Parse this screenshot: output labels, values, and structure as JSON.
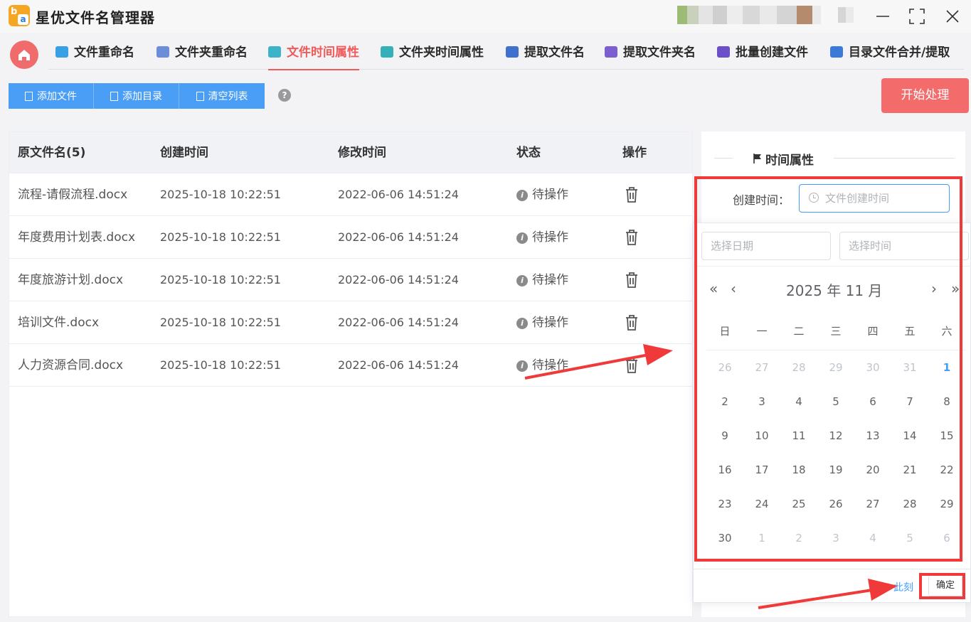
{
  "app": {
    "logo_b": "b",
    "logo_a": "a",
    "title": "星优文件名管理器"
  },
  "nav": {
    "items": [
      {
        "label": "文件重命名",
        "icon": "file-rename-icon",
        "color": "#3aa0e6"
      },
      {
        "label": "文件夹重命名",
        "icon": "folder-rename-icon",
        "color": "#6a8fd8"
      },
      {
        "label": "文件时间属性",
        "icon": "file-time-icon",
        "color": "#3bb3c8"
      },
      {
        "label": "文件夹时间属性",
        "icon": "folder-time-icon",
        "color": "#36b0b8"
      },
      {
        "label": "提取文件名",
        "icon": "extract-filename-icon",
        "color": "#3f6fcf"
      },
      {
        "label": "提取文件夹名",
        "icon": "extract-foldername-icon",
        "color": "#7b5fcf"
      },
      {
        "label": "批量创建文件",
        "icon": "batch-create-icon",
        "color": "#6a4fc8"
      },
      {
        "label": "目录文件合并/提取",
        "icon": "merge-extract-icon",
        "color": "#3a7ad8"
      }
    ],
    "active_index": 2
  },
  "toolbar": {
    "add_file": "添加文件",
    "add_dir": "添加目录",
    "clear_list": "清空列表",
    "help": "?",
    "start": "开始处理"
  },
  "table": {
    "headers": [
      "原文件名(5)",
      "创建时间",
      "修改时间",
      "状态",
      "操作"
    ],
    "rows": [
      {
        "name": "流程-请假流程.docx",
        "created": "2025-10-18 10:22:51",
        "modified": "2022-06-06 14:51:24",
        "status": "待操作"
      },
      {
        "name": "年度费用计划表.docx",
        "created": "2025-10-18 10:22:51",
        "modified": "2022-06-06 14:51:24",
        "status": "待操作"
      },
      {
        "name": "年度旅游计划.docx",
        "created": "2025-10-18 10:22:51",
        "modified": "2022-06-06 14:51:24",
        "status": "待操作"
      },
      {
        "name": "培训文件.docx",
        "created": "2025-10-18 10:22:51",
        "modified": "2022-06-06 14:51:24",
        "status": "待操作"
      },
      {
        "name": "人力资源合同.docx",
        "created": "2025-10-18 10:22:51",
        "modified": "2022-06-06 14:51:24",
        "status": "待操作"
      }
    ],
    "status_icon": "i"
  },
  "panel": {
    "title": "时间属性",
    "create_label": "创建时间：",
    "create_placeholder": "文件创建时间"
  },
  "picker": {
    "date_placeholder": "选择日期",
    "time_placeholder": "选择时间",
    "prev_year": "«",
    "prev_month": "‹",
    "next_month": "›",
    "next_year": "»",
    "month_label": "2025 年  11 月",
    "weekdays": [
      "日",
      "一",
      "二",
      "三",
      "四",
      "五",
      "六"
    ],
    "weeks": [
      [
        {
          "d": "26",
          "m": true
        },
        {
          "d": "27",
          "m": true
        },
        {
          "d": "28",
          "m": true
        },
        {
          "d": "29",
          "m": true
        },
        {
          "d": "30",
          "m": true
        },
        {
          "d": "31",
          "m": true
        },
        {
          "d": "1",
          "t": true
        }
      ],
      [
        {
          "d": "2"
        },
        {
          "d": "3"
        },
        {
          "d": "4"
        },
        {
          "d": "5"
        },
        {
          "d": "6"
        },
        {
          "d": "7"
        },
        {
          "d": "8"
        }
      ],
      [
        {
          "d": "9"
        },
        {
          "d": "10"
        },
        {
          "d": "11"
        },
        {
          "d": "12"
        },
        {
          "d": "13"
        },
        {
          "d": "14"
        },
        {
          "d": "15"
        }
      ],
      [
        {
          "d": "16"
        },
        {
          "d": "17"
        },
        {
          "d": "18"
        },
        {
          "d": "19"
        },
        {
          "d": "20"
        },
        {
          "d": "21"
        },
        {
          "d": "22"
        }
      ],
      [
        {
          "d": "23"
        },
        {
          "d": "24"
        },
        {
          "d": "25"
        },
        {
          "d": "26"
        },
        {
          "d": "27"
        },
        {
          "d": "28"
        },
        {
          "d": "29"
        }
      ],
      [
        {
          "d": "30"
        },
        {
          "d": "1",
          "m": true
        },
        {
          "d": "2",
          "m": true
        },
        {
          "d": "3",
          "m": true
        },
        {
          "d": "4",
          "m": true
        },
        {
          "d": "5",
          "m": true
        },
        {
          "d": "6",
          "m": true
        }
      ]
    ],
    "now": "此刻",
    "confirm": "确定"
  },
  "colors": {
    "accent": "#ef5b5b",
    "primary": "#4a9ef5",
    "annotation": "#f03a3a"
  }
}
